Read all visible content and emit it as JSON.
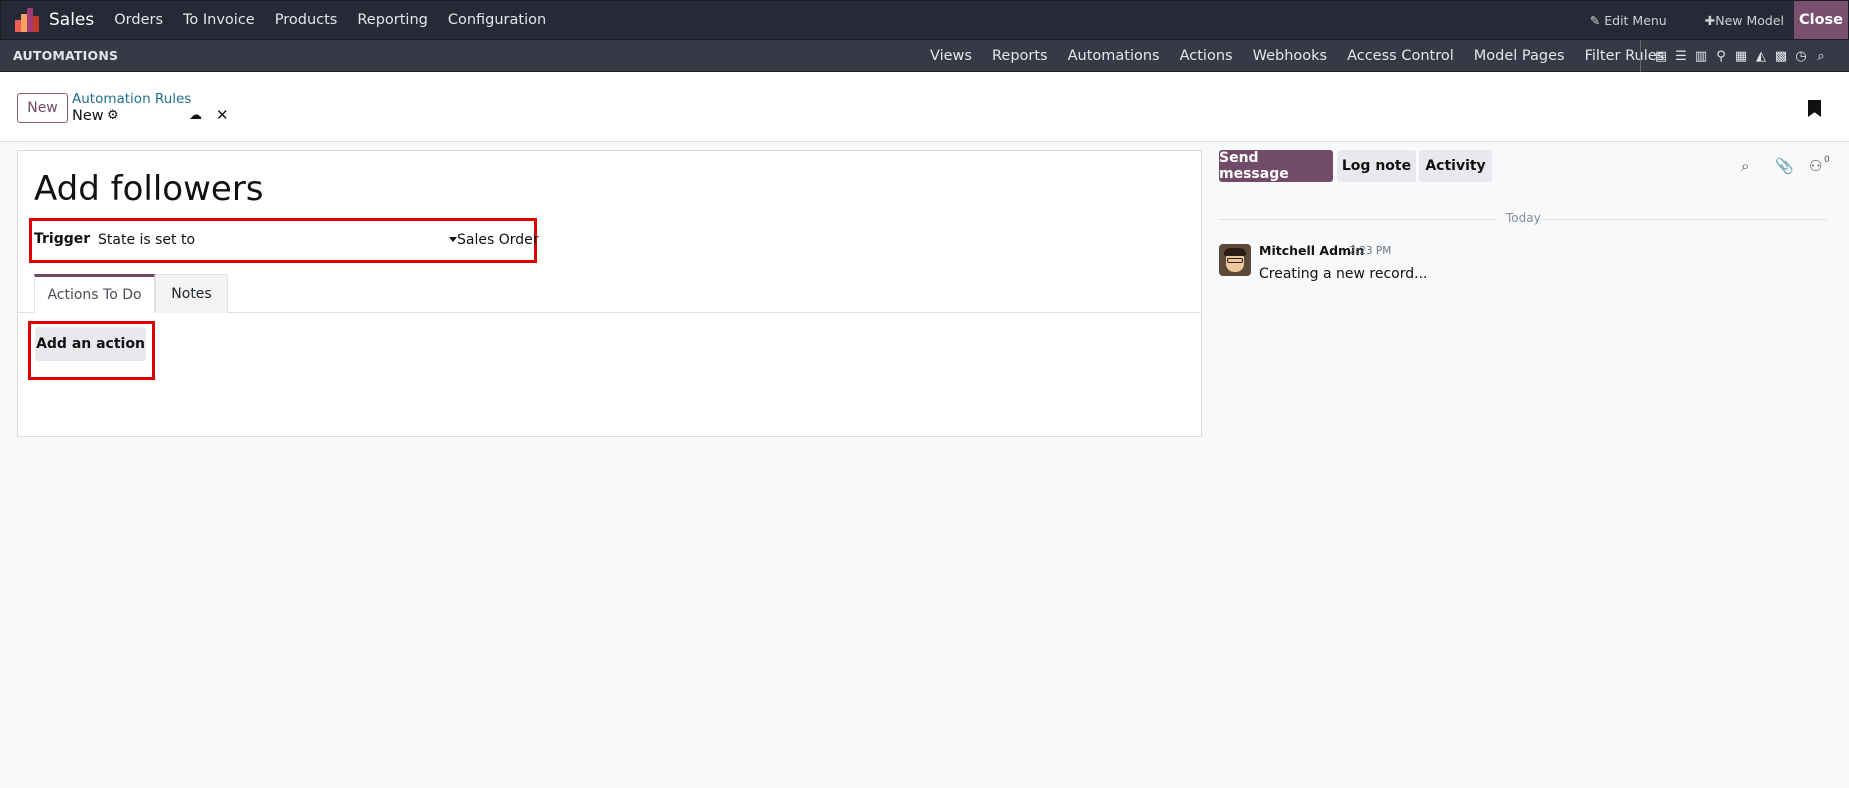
{
  "app": {
    "name": "Sales",
    "menu": [
      "Orders",
      "To Invoice",
      "Products",
      "Reporting",
      "Configuration"
    ],
    "edit_menu": "Edit Menu",
    "new_model": "New Model",
    "close": "Close"
  },
  "studio": {
    "title": "AUTOMATIONS",
    "nav": [
      "Views",
      "Reports",
      "Automations",
      "Actions",
      "Webhooks",
      "Access Control",
      "Model Pages",
      "Filter Rules"
    ],
    "view_icons": [
      "form-view-icon",
      "list-view-icon",
      "kanban-view-icon",
      "map-view-icon",
      "calendar-view-icon",
      "graph-view-icon",
      "pivot-view-icon",
      "activity-view-icon",
      "search-view-icon"
    ]
  },
  "control": {
    "new_label": "New",
    "breadcrumb_parent": "Automation Rules",
    "breadcrumb_current": "New"
  },
  "form": {
    "title": "Add followers",
    "trigger_label": "Trigger",
    "trigger_value": "State is set to",
    "model_value": "Sales Order",
    "tabs": [
      "Actions To Do",
      "Notes"
    ],
    "add_action_label": "Add an action"
  },
  "chatter": {
    "send_message": "Send message",
    "log_note": "Log note",
    "activity": "Activity",
    "follower_count": "0",
    "date_separator": "Today",
    "messages": [
      {
        "author": "Mitchell Admin",
        "time": "2:23 PM",
        "body": "Creating a new record..."
      }
    ]
  },
  "colors": {
    "navbar": "#262a36",
    "studio_bar": "#353a46",
    "primary": "#714b67",
    "highlight_border": "#dd0000"
  }
}
